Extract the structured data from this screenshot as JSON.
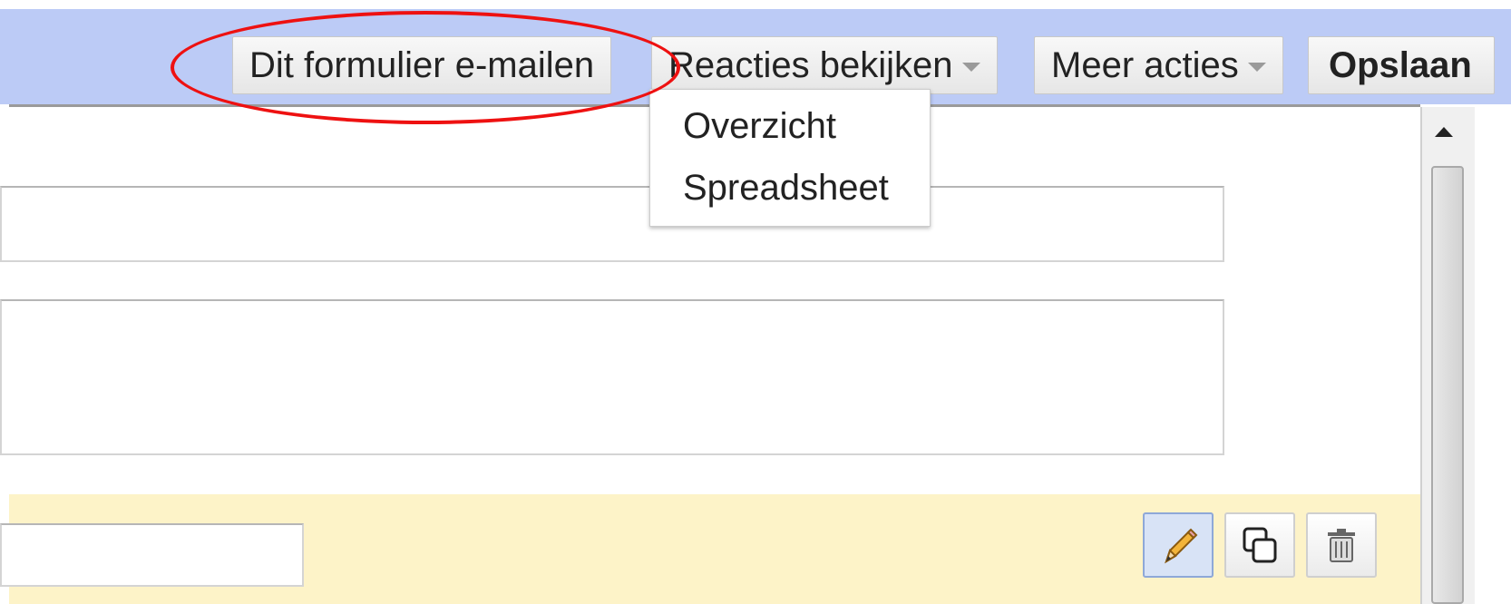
{
  "toolbar": {
    "email_form": "Dit formulier e-mailen",
    "view_responses": "Reacties bekijken",
    "more_actions": "Meer acties",
    "save": "Opslaan"
  },
  "responses_menu": {
    "items": [
      {
        "label": "Overzicht"
      },
      {
        "label": "Spreadsheet"
      }
    ]
  },
  "question_tools": {
    "edit_icon": "pencil-icon",
    "duplicate_icon": "duplicate-icon",
    "delete_icon": "trash-icon"
  },
  "colors": {
    "toolbar_bg": "#bccbf6",
    "highlight_bg": "#fdf3c8",
    "annotation": "#ee1111"
  }
}
